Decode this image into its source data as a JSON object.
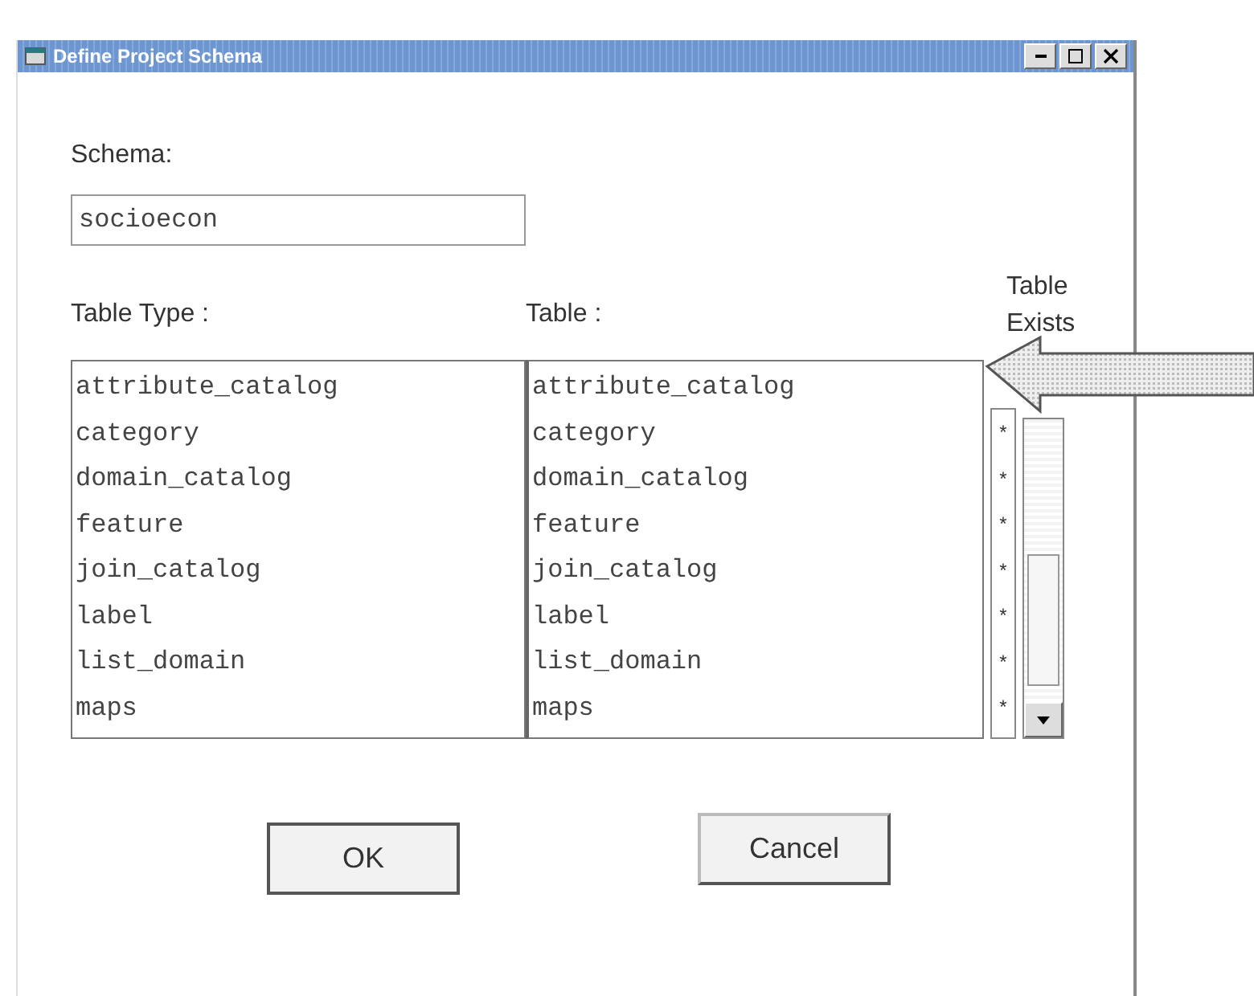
{
  "window": {
    "title": "Define Project Schema"
  },
  "schema": {
    "label": "Schema:",
    "value": "socioecon"
  },
  "table_type": {
    "label": "Table Type :",
    "items": [
      "attribute_catalog",
      "category",
      "domain_catalog",
      "feature",
      "join_catalog",
      "label",
      "list_domain",
      "maps"
    ]
  },
  "table": {
    "label": "Table :",
    "items": [
      "attribute_catalog",
      "category",
      "domain_catalog",
      "feature",
      "join_catalog",
      "label",
      "list_domain",
      "maps"
    ]
  },
  "table_exists": {
    "label": "Table Exists",
    "marks": [
      "*",
      "*",
      "*",
      "*",
      "*",
      "*",
      "*"
    ]
  },
  "buttons": [
    "OK",
    "Cancel"
  ]
}
